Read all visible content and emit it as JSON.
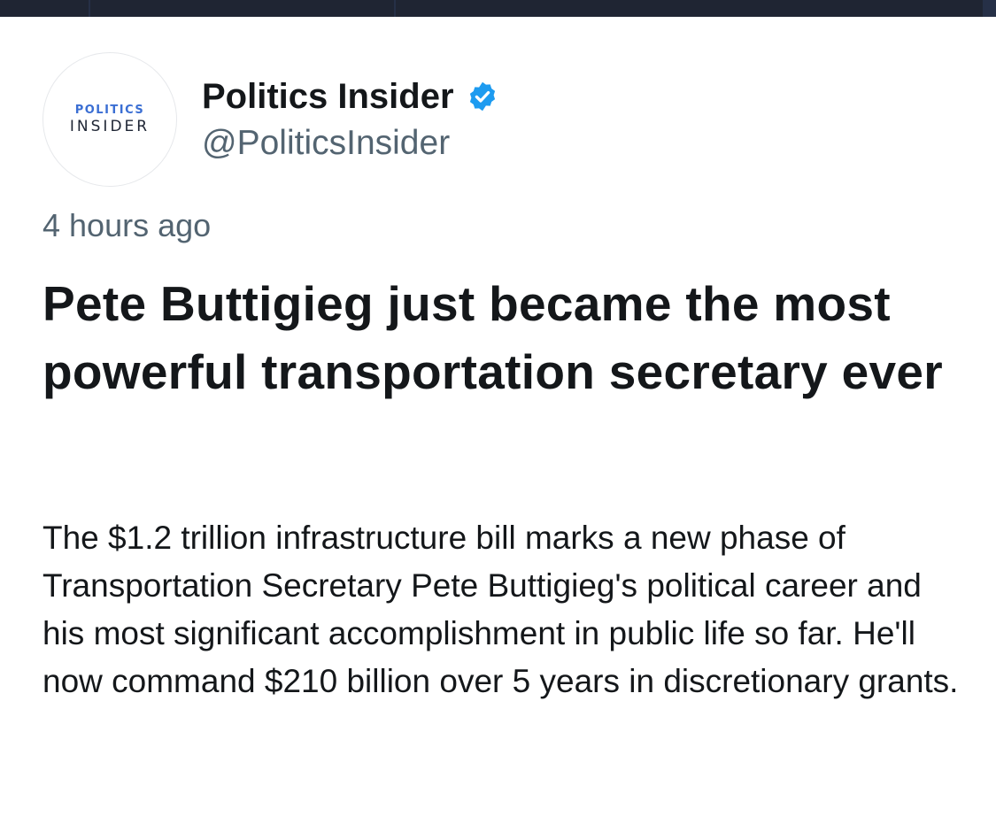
{
  "account": {
    "avatar_line1": "POLITICS",
    "avatar_line2": "INSIDER",
    "display_name": "Politics Insider",
    "handle": "@PoliticsInsider",
    "verified_icon": "verified-badge-icon"
  },
  "post": {
    "timestamp": "4 hours ago",
    "headline": "Pete Buttigieg just became the most powerful transportation secretary ever",
    "summary": "The $1.2 trillion infrastructure bill marks a new phase of Transportation Secretary Pete Buttigieg's political career and his most significant accomplishment in public life so far. He'll now command $210 billion over 5 years in discretionary grants."
  },
  "colors": {
    "verified_blue": "#1d9bf0",
    "avatar_blue": "#3a6ed3",
    "secondary_text": "#536471",
    "primary_text": "#14171a",
    "top_bar": "#1f2533"
  }
}
